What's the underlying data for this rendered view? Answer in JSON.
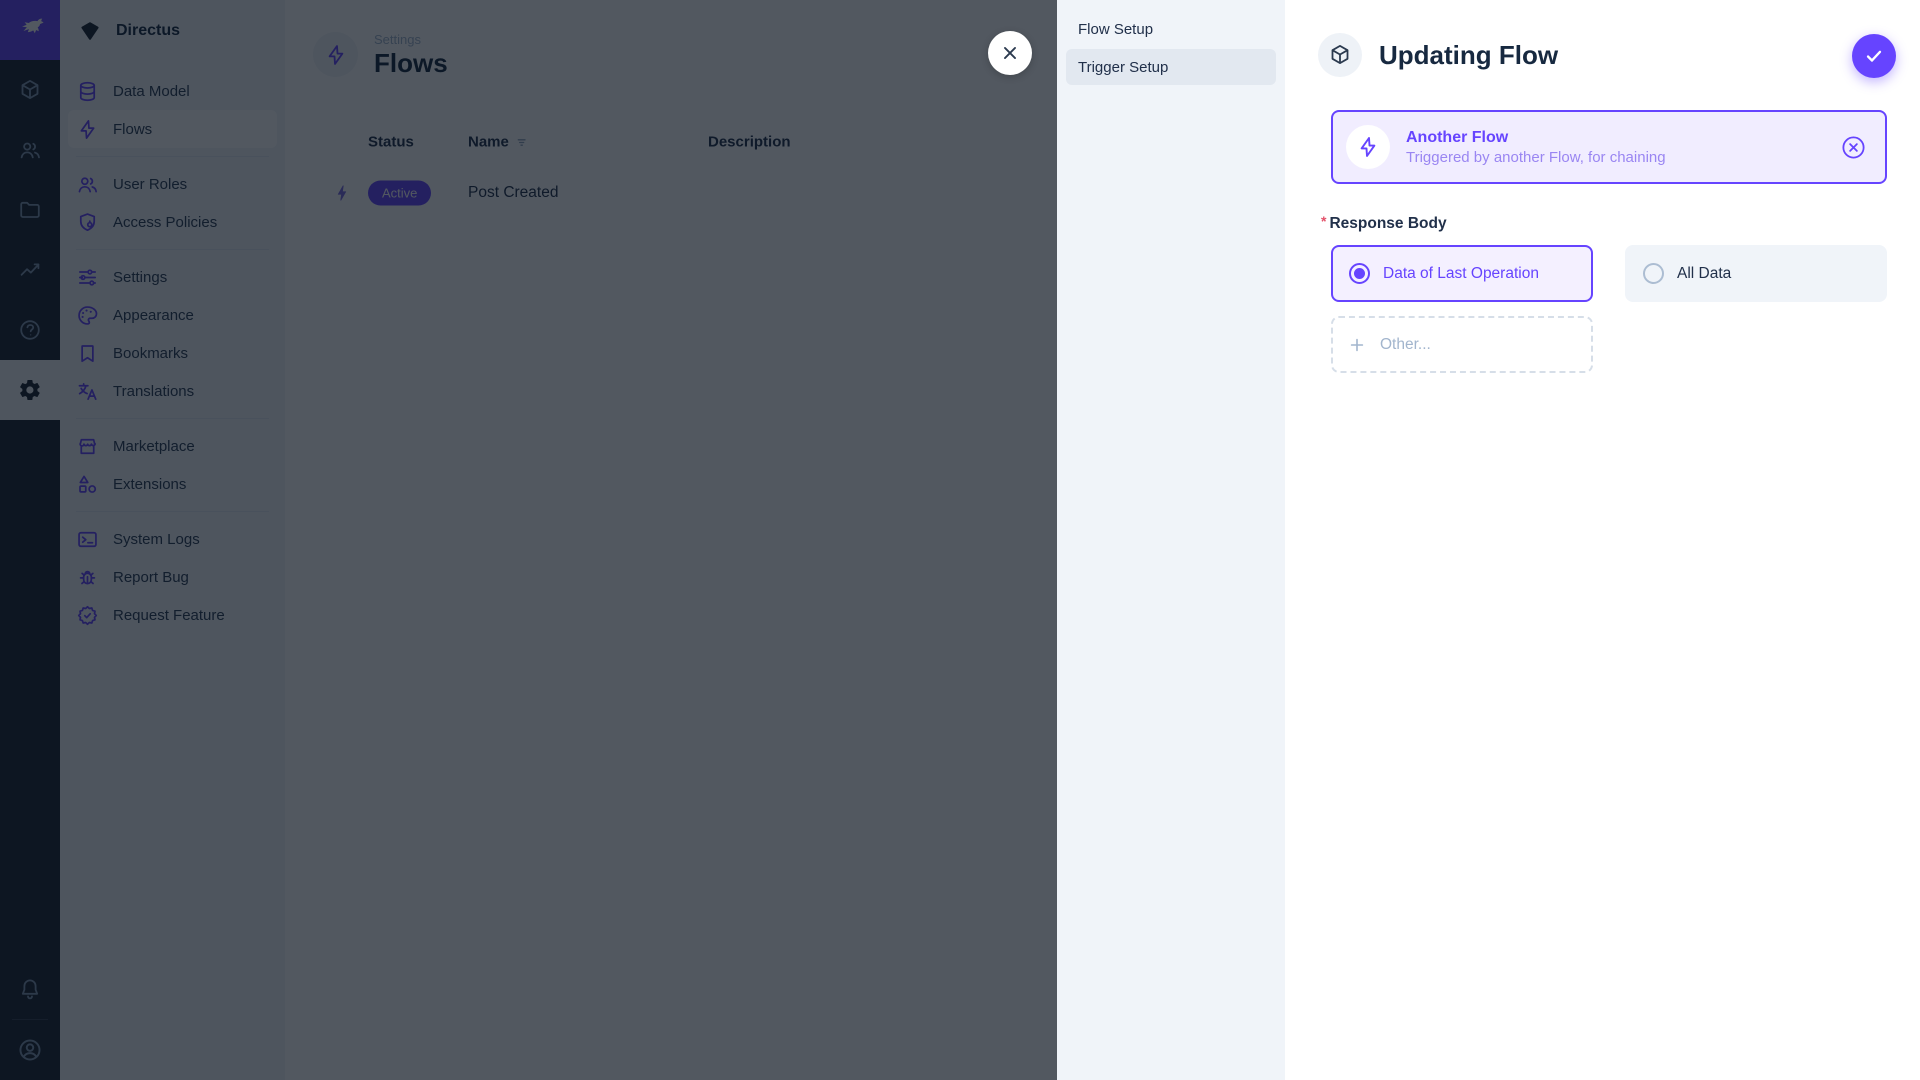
{
  "app": {
    "product": "Directus"
  },
  "colors": {
    "accent": "#6644ff",
    "text": "#172940",
    "muted": "#a2b5cd",
    "danger": "#e35169",
    "module_bar_bg": "#18222f",
    "nav_bg": "#f0f4f9",
    "trigger_card_bg": "#f1edff",
    "overlay": "rgba(9,17,28,0.7)"
  },
  "module_bar": {
    "logo_icon": "directus-rabbit-icon",
    "items": [
      {
        "name": "content",
        "icon": "box-icon"
      },
      {
        "name": "user-directory",
        "icon": "people-icon"
      },
      {
        "name": "files",
        "icon": "folder-icon"
      },
      {
        "name": "insights",
        "icon": "chart-icon"
      },
      {
        "name": "help",
        "icon": "help-icon"
      },
      {
        "name": "settings",
        "icon": "gear-icon",
        "active": true
      }
    ],
    "bottom_items": [
      {
        "name": "notifications",
        "icon": "bell-icon"
      },
      {
        "name": "account",
        "icon": "user-circle-icon"
      }
    ]
  },
  "sidebar": {
    "project_name": "Directus",
    "project_icon": "gem-icon",
    "items": [
      {
        "label": "Data Model",
        "icon": "database-icon"
      },
      {
        "label": "Flows",
        "icon": "bolt-icon",
        "active": true
      },
      {
        "label": "User Roles",
        "icon": "people-icon"
      },
      {
        "label": "Access Policies",
        "icon": "shield-lock-icon"
      },
      {
        "label": "Settings",
        "icon": "sliders-icon"
      },
      {
        "label": "Appearance",
        "icon": "palette-icon"
      },
      {
        "label": "Bookmarks",
        "icon": "bookmark-icon"
      },
      {
        "label": "Translations",
        "icon": "translate-icon"
      },
      {
        "label": "Marketplace",
        "icon": "storefront-icon"
      },
      {
        "label": "Extensions",
        "icon": "shapes-icon"
      },
      {
        "label": "System Logs",
        "icon": "terminal-icon"
      },
      {
        "label": "Report Bug",
        "icon": "bug-icon"
      },
      {
        "label": "Request Feature",
        "icon": "badge-check-icon"
      }
    ]
  },
  "main": {
    "breadcrumb": "Settings",
    "title": "Flows",
    "title_icon": "bolt-icon",
    "table": {
      "columns": [
        "Status",
        "Name",
        "Description"
      ],
      "rows": [
        {
          "status": "Active",
          "name": "Post Created",
          "description": ""
        }
      ]
    }
  },
  "drawer": {
    "nav": [
      {
        "label": "Flow Setup",
        "active": false
      },
      {
        "label": "Trigger Setup",
        "active": true
      }
    ],
    "title": "Updating Flow",
    "title_icon": "box-icon",
    "confirm_icon": "check-icon",
    "trigger_card": {
      "icon": "bolt-icon",
      "title": "Another Flow",
      "subtitle": "Triggered by another Flow, for chaining",
      "deselect_icon": "x-circle-icon"
    },
    "form": {
      "field_label": "Response Body",
      "required_marker": "*",
      "options": [
        {
          "label": "Data of Last Operation",
          "selected": true
        },
        {
          "label": "All Data",
          "selected": false
        }
      ],
      "other_placeholder": "Other..."
    }
  }
}
